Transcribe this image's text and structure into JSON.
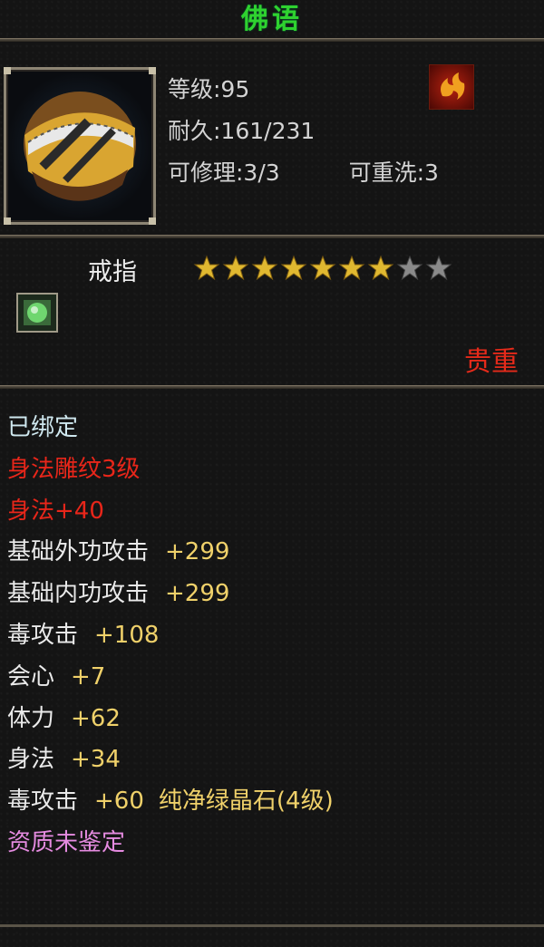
{
  "item": {
    "name": "佛语",
    "icon": "ring-icon",
    "level_label": "等级:95",
    "durability_label": "耐久:161/231",
    "repair_label": "可修理:3/3",
    "rewash_label": "可重洗:3",
    "type_label": "戒指",
    "stars_total": 9,
    "stars_filled": 7,
    "gem_slot_icon": "green-gem-icon",
    "quality_label": "贵重"
  },
  "properties": [
    {
      "text": "已绑定",
      "color": "white"
    },
    {
      "text": "身法雕纹3级",
      "color": "red"
    },
    {
      "text": "身法+40",
      "color": "red"
    },
    {
      "name": "基础外功攻击",
      "value": "+299"
    },
    {
      "name": "基础内功攻击",
      "value": "+299"
    },
    {
      "name": "毒攻击",
      "value": "+108"
    },
    {
      "name": "会心",
      "value": "+7"
    },
    {
      "name": "体力",
      "value": "+62"
    },
    {
      "name": "身法",
      "value": "+34"
    },
    {
      "name": "毒攻击",
      "value": "+60",
      "extra": "纯净绿晶石(4级)"
    },
    {
      "text": "资质未鉴定",
      "color": "purple"
    }
  ],
  "colors": {
    "title": "#2fd22f",
    "quality": "#e52a1a",
    "gold": "#f0d16a",
    "purple": "#e58be0"
  }
}
